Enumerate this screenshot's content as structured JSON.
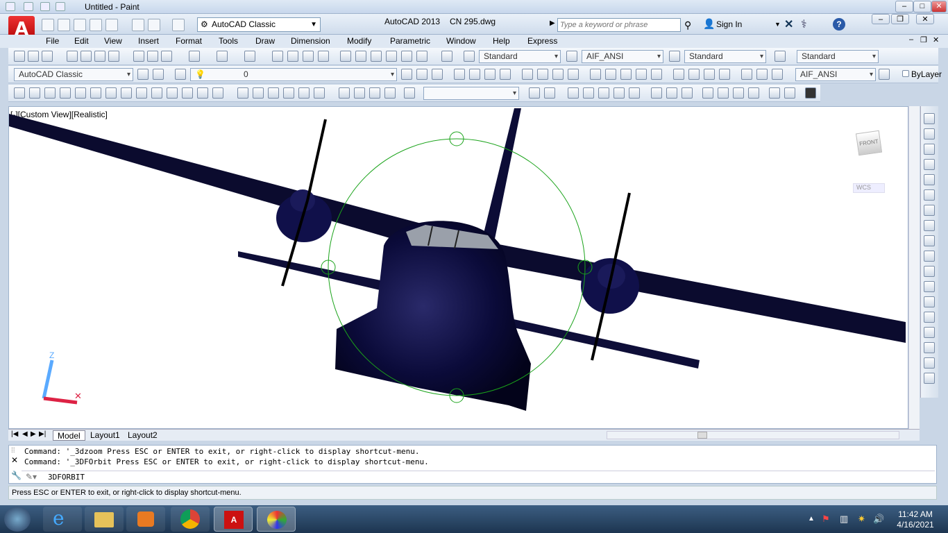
{
  "paint": {
    "title": "Untitled - Paint"
  },
  "acad": {
    "workspace": "AutoCAD Classic",
    "product": "AutoCAD 2013",
    "file": "CN 295.dwg",
    "search_placeholder": "Type a keyword or phrase",
    "sign_in": "Sign In"
  },
  "menu": [
    "File",
    "Edit",
    "View",
    "Insert",
    "Format",
    "Tools",
    "Draw",
    "Dimension",
    "Modify",
    "Parametric",
    "Window",
    "Help",
    "Express"
  ],
  "styles": {
    "text_style": "Standard",
    "dim_style": "AIF_ANSI",
    "table_style": "Standard",
    "mleader_style": "Standard"
  },
  "toolbar2": {
    "workspace": "AutoCAD Classic",
    "layer": "0",
    "dimstyle": "AIF_ANSI",
    "color": "ByLayer"
  },
  "viewport": {
    "label": "[-][Custom View][Realistic]",
    "viewcube": "FRONT",
    "wcs": "WCS",
    "ucs_z": "Z"
  },
  "tabs": [
    "Model",
    "Layout1",
    "Layout2"
  ],
  "command": {
    "lines": [
      "Command: '_3dzoom Press ESC or ENTER to exit, or right-click to display shortcut-menu.",
      "Command: '_3DFOrbit Press ESC or ENTER to exit, or right-click to display shortcut-menu."
    ],
    "input": "3DFORBIT"
  },
  "status": "Press ESC or ENTER to exit, or right-click to display shortcut-menu.",
  "clock": {
    "time": "11:42 AM",
    "date": "4/16/2021"
  },
  "colors": {
    "aircraft": "#0b0b3a",
    "orbit": "#1aa31a"
  }
}
